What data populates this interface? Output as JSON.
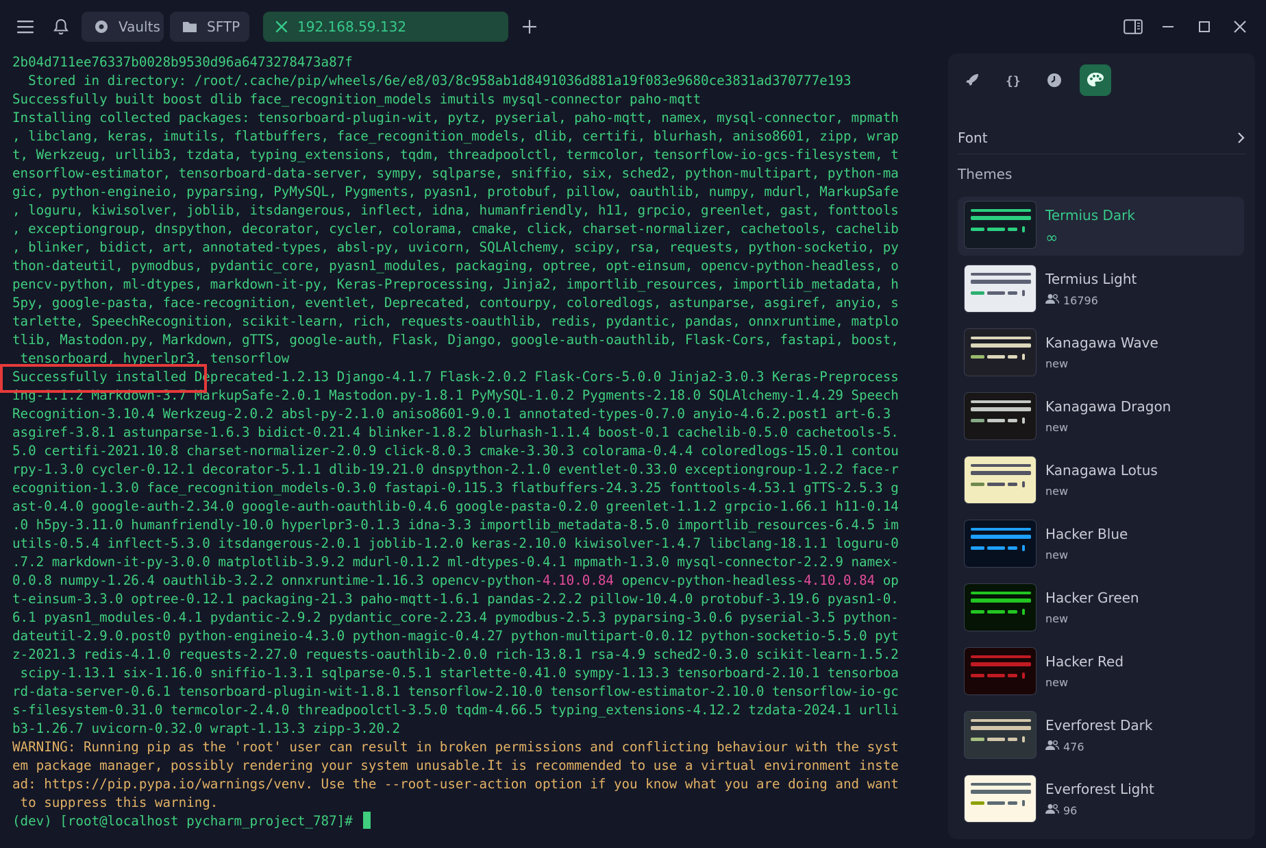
{
  "tabs": {
    "vaults_label": "Vaults",
    "sftp_label": "SFTP",
    "host_label": "192.168.59.132"
  },
  "terminal": {
    "lines": [
      {
        "text": "2b04d711ee76337b0028b9530d96a6473278473a87f"
      },
      {
        "text": "  Stored in directory: /root/.cache/pip/wheels/6e/e8/03/8c958ab1d8491036d881a19f083e9680ce3831ad370777e193"
      },
      {
        "text": "Successfully built boost dlib face_recognition_models imutils mysql-connector paho-mqtt"
      },
      {
        "text": "Installing collected packages: tensorboard-plugin-wit, pytz, pyserial, paho-mqtt, namex, mysql-connector, mpmath"
      },
      {
        "text": ", libclang, keras, imutils, flatbuffers, face_recognition_models, dlib, certifi, blurhash, aniso8601, zipp, wrap"
      },
      {
        "text": "t, Werkzeug, urllib3, tzdata, typing_extensions, tqdm, threadpoolctl, termcolor, tensorflow-io-gcs-filesystem, t"
      },
      {
        "text": "ensorflow-estimator, tensorboard-data-server, sympy, sqlparse, sniffio, six, sched2, python-multipart, python-ma"
      },
      {
        "text": "gic, python-engineio, pyparsing, PyMySQL, Pygments, pyasn1, protobuf, pillow, oauthlib, numpy, mdurl, MarkupSafe"
      },
      {
        "text": ", loguru, kiwisolver, joblib, itsdangerous, inflect, idna, humanfriendly, h11, grpcio, greenlet, gast, fonttools"
      },
      {
        "text": ", exceptiongroup, dnspython, decorator, cycler, colorama, cmake, click, charset-normalizer, cachetools, cachelib"
      },
      {
        "text": ", blinker, bidict, art, annotated-types, absl-py, uvicorn, SQLAlchemy, scipy, rsa, requests, python-socketio, py"
      },
      {
        "text": "thon-dateutil, pymodbus, pydantic_core, pyasn1_modules, packaging, optree, opt-einsum, opencv-python-headless, o"
      },
      {
        "text": "pencv-python, ml-dtypes, markdown-it-py, Keras-Preprocessing, Jinja2, importlib_resources, importlib_metadata, h"
      },
      {
        "text": "5py, google-pasta, face-recognition, eventlet, Deprecated, contourpy, coloredlogs, astunparse, asgiref, anyio, s"
      },
      {
        "text": "tarlette, SpeechRecognition, scikit-learn, rich, requests-oauthlib, redis, pydantic, pandas, onnxruntime, matplo"
      },
      {
        "text": "tlib, Mastodon.py, Markdown, gTTS, google-auth, Flask, Django, google-auth-oauthlib, Flask-Cors, fastapi, boost,"
      },
      {
        "text": " tensorboard, hyperlpr3, tensorflow"
      },
      {
        "text": "Successfully installed Deprecated-1.2.13 Django-4.1.7 Flask-2.0.2 Flask-Cors-5.0.0 Jinja2-3.0.3 Keras-Preprocess"
      },
      {
        "text": "ing-1.1.2 Markdown-3.7 MarkupSafe-2.0.1 Mastodon.py-1.8.1 PyMySQL-1.0.2 Pygments-2.18.0 SQLAlchemy-1.4.29 Speech"
      },
      {
        "text": "Recognition-3.10.4 Werkzeug-2.0.2 absl-py-2.1.0 aniso8601-9.0.1 annotated-types-0.7.0 anyio-4.6.2.post1 art-6.3"
      },
      {
        "text": "asgiref-3.8.1 astunparse-1.6.3 bidict-0.21.4 blinker-1.8.2 blurhash-1.1.4 boost-0.1 cachelib-0.5.0 cachetools-5."
      },
      {
        "text": "5.0 certifi-2021.10.8 charset-normalizer-2.0.9 click-8.0.3 cmake-3.30.3 colorama-0.4.4 coloredlogs-15.0.1 contou"
      },
      {
        "text": "rpy-1.3.0 cycler-0.12.1 decorator-5.1.1 dlib-19.21.0 dnspython-2.1.0 eventlet-0.33.0 exceptiongroup-1.2.2 face-r"
      },
      {
        "text": "ecognition-1.3.0 face_recognition_models-0.3.0 fastapi-0.115.3 flatbuffers-24.3.25 fonttools-4.53.1 gTTS-2.5.3 g"
      },
      {
        "text": "ast-0.4.0 google-auth-2.34.0 google-auth-oauthlib-0.4.6 google-pasta-0.2.0 greenlet-1.1.2 grpcio-1.66.1 h11-0.14"
      },
      {
        "text": ".0 h5py-3.11.0 humanfriendly-10.0 hyperlpr3-0.1.3 idna-3.3 importlib_metadata-8.5.0 importlib_resources-6.4.5 im"
      },
      {
        "text": "utils-0.5.4 inflect-5.3.0 itsdangerous-2.0.1 joblib-1.2.0 keras-2.10.0 kiwisolver-1.4.7 libclang-18.1.1 loguru-0"
      },
      {
        "text": ".7.2 markdown-it-py-3.0.0 matplotlib-3.9.2 mdurl-0.1.2 ml-dtypes-0.4.1 mpmath-1.3.0 mysql-connector-2.2.9 namex-"
      },
      {
        "text": "0.0.8 numpy-1.26.4 oauthlib-3.2.2 onnxruntime-1.16.3 opencv-python-",
        "pink1": "4.10.0.84",
        "mid": " opencv-python-headless-",
        "pink2": "4.10.0.84",
        "tail": " op"
      },
      {
        "text": "t-einsum-3.3.0 optree-0.12.1 packaging-21.3 paho-mqtt-1.6.1 pandas-2.2.2 pillow-10.4.0 protobuf-3.19.6 pyasn1-0."
      },
      {
        "text": "6.1 pyasn1_modules-0.4.1 pydantic-2.9.2 pydantic_core-2.23.4 pymodbus-2.5.3 pyparsing-3.0.6 pyserial-3.5 python-"
      },
      {
        "text": "dateutil-2.9.0.post0 python-engineio-4.3.0 python-magic-0.4.27 python-multipart-0.0.12 python-socketio-5.5.0 pyt"
      },
      {
        "text": "z-2021.3 redis-4.1.0 requests-2.27.0 requests-oauthlib-2.0.0 rich-13.8.1 rsa-4.9 sched2-0.3.0 scikit-learn-1.5.2"
      },
      {
        "text": " scipy-1.13.1 six-1.16.0 sniffio-1.3.1 sqlparse-0.5.1 starlette-0.41.0 sympy-1.13.3 tensorboard-2.10.1 tensorboa"
      },
      {
        "text": "rd-data-server-0.6.1 tensorboard-plugin-wit-1.8.1 tensorflow-2.10.0 tensorflow-estimator-2.10.0 tensorflow-io-gc"
      },
      {
        "text": "s-filesystem-0.31.0 termcolor-2.4.0 threadpoolctl-3.5.0 tqdm-4.66.5 typing_extensions-4.12.2 tzdata-2024.1 urlli"
      },
      {
        "text": "b3-1.26.7 uvicorn-0.32.0 wrapt-1.13.3 zipp-3.20.2"
      },
      {
        "text": "WARNING: Running pip as the 'root' user can result in broken permissions and conflicting behaviour with the syst",
        "warn": true
      },
      {
        "text": "em package manager, possibly rendering your system unusable.It is recommended to use a virtual environment inste",
        "warn": true
      },
      {
        "text": "ad: https://pip.pypa.io/warnings/venv. Use the --root-user-action option if you know what you are doing and want",
        "warn": true
      },
      {
        "text": " to suppress this warning.",
        "warn": true
      }
    ],
    "prompt": "(dev) [root@localhost pycharm_project_787]# "
  },
  "panel": {
    "font_label": "Font",
    "themes_title": "Themes",
    "themes": [
      {
        "name": "Termius Dark",
        "sub": "∞",
        "selected": true,
        "users": false,
        "bg": "#141a24",
        "bar1": "#2bd07f",
        "bar2": "#2bd07f",
        "rows": [
          "#2bd07f",
          "#2bd07f",
          "#2bd07f"
        ]
      },
      {
        "name": "Termius Light",
        "sub": "16796",
        "selected": false,
        "users": true,
        "bg": "#e8ebf0",
        "bar1": "#5d6274",
        "bar2": "#5d6274",
        "rows": [
          "#2bb070",
          "#5d6274",
          "#5d6274"
        ]
      },
      {
        "name": "Kanagawa Wave",
        "sub": "new",
        "selected": false,
        "users": false,
        "bg": "#1f1f28",
        "bar1": "#dcd7ba",
        "bar2": "#dcd7ba",
        "rows": [
          "#98bb6c",
          "#dcd7ba",
          "#dcd7ba"
        ]
      },
      {
        "name": "Kanagawa Dragon",
        "sub": "new",
        "selected": false,
        "users": false,
        "bg": "#181616",
        "bar1": "#c5c9c5",
        "bar2": "#c5c9c5",
        "rows": [
          "#87a987",
          "#c5c9c5",
          "#c5c9c5"
        ]
      },
      {
        "name": "Kanagawa Lotus",
        "sub": "new",
        "selected": false,
        "users": false,
        "bg": "#f2ecbc",
        "bar1": "#545464",
        "bar2": "#545464",
        "rows": [
          "#6f894e",
          "#545464",
          "#545464"
        ]
      },
      {
        "name": "Hacker Blue",
        "sub": "new",
        "selected": false,
        "users": false,
        "bg": "#07101f",
        "bar1": "#1ea0ff",
        "bar2": "#1ea0ff",
        "rows": [
          "#1ea0ff",
          "#1ea0ff",
          "#1ea0ff"
        ]
      },
      {
        "name": "Hacker Green",
        "sub": "new",
        "selected": false,
        "users": false,
        "bg": "#051405",
        "bar1": "#22c522",
        "bar2": "#22c522",
        "rows": [
          "#22c522",
          "#22c522",
          "#22c522"
        ]
      },
      {
        "name": "Hacker Red",
        "sub": "new",
        "selected": false,
        "users": false,
        "bg": "#1a0506",
        "bar1": "#c01a22",
        "bar2": "#c01a22",
        "rows": [
          "#c01a22",
          "#c01a22",
          "#c01a22"
        ]
      },
      {
        "name": "Everforest Dark",
        "sub": "476",
        "selected": false,
        "users": true,
        "bg": "#2d353b",
        "bar1": "#d3c6aa",
        "bar2": "#d3c6aa",
        "rows": [
          "#a7c080",
          "#d3c6aa",
          "#d3c6aa"
        ]
      },
      {
        "name": "Everforest Light",
        "sub": "96",
        "selected": false,
        "users": true,
        "bg": "#fdf6e3",
        "bar1": "#5c6a72",
        "bar2": "#5c6a72",
        "rows": [
          "#8da101",
          "#5c6a72",
          "#5c6a72"
        ]
      }
    ]
  },
  "colors": {
    "accent": "#37c98a",
    "terminal_text": "#3fcf7e",
    "warning_text": "#e3b265",
    "highlight_box": "#e53a3a",
    "version_highlight": "#e44d9b"
  }
}
